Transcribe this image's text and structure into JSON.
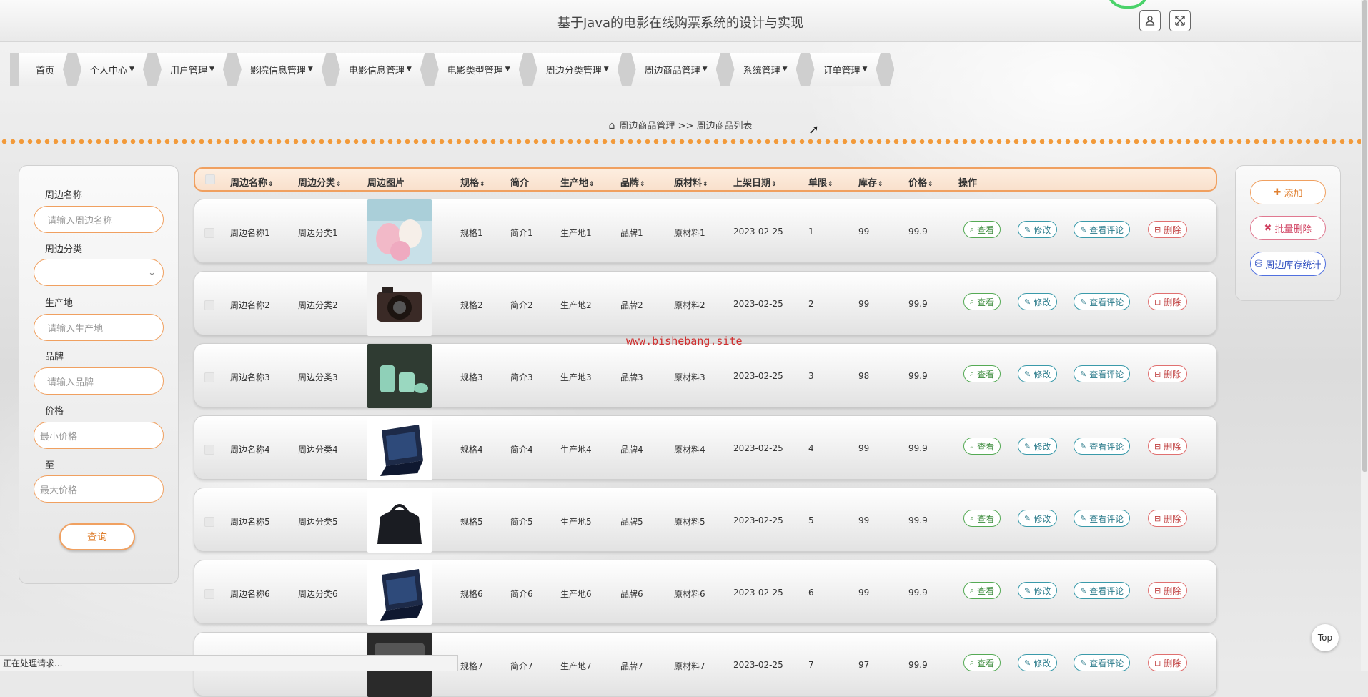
{
  "header": {
    "title": "基于Java的电影在线购票系统的设计与实现"
  },
  "nav": [
    {
      "label": "首页",
      "caret": false
    },
    {
      "label": "个人中心",
      "caret": true
    },
    {
      "label": "用户管理",
      "caret": true
    },
    {
      "label": "影院信息管理",
      "caret": true
    },
    {
      "label": "电影信息管理",
      "caret": true
    },
    {
      "label": "电影类型管理",
      "caret": true
    },
    {
      "label": "周边分类管理",
      "caret": true
    },
    {
      "label": "周边商品管理",
      "caret": true
    },
    {
      "label": "系统管理",
      "caret": true
    },
    {
      "label": "订单管理",
      "caret": true
    }
  ],
  "breadcrumb": {
    "parent": "周边商品管理",
    "sep": ">>",
    "current": "周边商品列表"
  },
  "search": {
    "name_label": "周边名称",
    "name_placeholder": "请输入周边名称",
    "category_label": "周边分类",
    "category_value": "",
    "origin_label": "生产地",
    "origin_placeholder": "请输入生产地",
    "brand_label": "品牌",
    "brand_placeholder": "请输入品牌",
    "price_label": "价格",
    "min_placeholder": "最小价格",
    "to_label": "至",
    "max_placeholder": "最大价格",
    "submit": "查询"
  },
  "actions": {
    "add": "添加",
    "batch_delete": "批量删除",
    "stock_stats": "周边库存统计"
  },
  "table": {
    "headers": [
      "周边名称",
      "周边分类",
      "周边图片",
      "规格",
      "简介",
      "生产地",
      "品牌",
      "原材料",
      "上架日期",
      "单限",
      "库存",
      "价格",
      "操作"
    ],
    "rows": [
      {
        "name": "周边名称1",
        "cat": "周边分类1",
        "spec": "规格1",
        "intro": "简介1",
        "origin": "生产地1",
        "brand": "品牌1",
        "material": "原材料1",
        "date": "2023-02-25",
        "limit": "1",
        "stock": "99",
        "price": "99.9"
      },
      {
        "name": "周边名称2",
        "cat": "周边分类2",
        "spec": "规格2",
        "intro": "简介2",
        "origin": "生产地2",
        "brand": "品牌2",
        "material": "原材料2",
        "date": "2023-02-25",
        "limit": "2",
        "stock": "99",
        "price": "99.9"
      },
      {
        "name": "周边名称3",
        "cat": "周边分类3",
        "spec": "规格3",
        "intro": "简介3",
        "origin": "生产地3",
        "brand": "品牌3",
        "material": "原材料3",
        "date": "2023-02-25",
        "limit": "3",
        "stock": "98",
        "price": "99.9"
      },
      {
        "name": "周边名称4",
        "cat": "周边分类4",
        "spec": "规格4",
        "intro": "简介4",
        "origin": "生产地4",
        "brand": "品牌4",
        "material": "原材料4",
        "date": "2023-02-25",
        "limit": "4",
        "stock": "99",
        "price": "99.9"
      },
      {
        "name": "周边名称5",
        "cat": "周边分类5",
        "spec": "规格5",
        "intro": "简介5",
        "origin": "生产地5",
        "brand": "品牌5",
        "material": "原材料5",
        "date": "2023-02-25",
        "limit": "5",
        "stock": "99",
        "price": "99.9"
      },
      {
        "name": "周边名称6",
        "cat": "周边分类6",
        "spec": "规格6",
        "intro": "简介6",
        "origin": "生产地6",
        "brand": "品牌6",
        "material": "原材料6",
        "date": "2023-02-25",
        "limit": "6",
        "stock": "99",
        "price": "99.9"
      },
      {
        "name": "",
        "cat": "",
        "spec": "规格7",
        "intro": "简介7",
        "origin": "生产地7",
        "brand": "品牌7",
        "material": "原材料7",
        "date": "2023-02-25",
        "limit": "7",
        "stock": "97",
        "price": "99.9"
      }
    ],
    "ops": {
      "view": "查看",
      "edit": "修改",
      "comment": "查看评论",
      "delete": "删除"
    }
  },
  "watermark": "www.bishebang.site",
  "status": "正在处理请求...",
  "top_button": "Top",
  "colors": {
    "accent": "#f0a060",
    "view": "#55aa55",
    "edit": "#3a9aaa",
    "delete": "#e07070",
    "stats": "#5070e0"
  }
}
